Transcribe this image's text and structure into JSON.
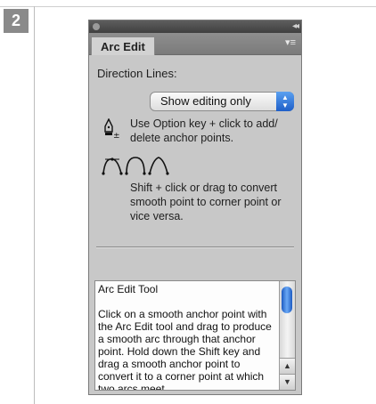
{
  "step": {
    "number": "2"
  },
  "panel": {
    "tab_label": "Arc Edit",
    "menu_glyph": "▾≡",
    "collapse_glyph": "◂◂",
    "direction_lines_label": "Direction Lines:",
    "direction_select_value": "Show editing only",
    "hint_anchor": "Use Option key + click to add/ delete anchor points.",
    "hint_convert": "Shift + click or drag to convert smooth point to corner point or vice versa.",
    "help_title": "Arc Edit Tool",
    "help_body": "Click on a smooth anchor point with the Arc Edit tool and drag to produce a smooth arc through that anchor point.  Hold down the Shift key and drag a smooth anchor point to convert it to a corner point at which two arcs meet."
  },
  "colors": {
    "accent": "#2a6fd8",
    "panel_bg": "#c8c8c8"
  },
  "icons": {
    "pen_add": "pen-plus-minus-icon",
    "arc_variants": "arc-point-icons",
    "scroll_up": "scroll-up-arrow-icon",
    "scroll_down": "scroll-down-arrow-icon"
  }
}
